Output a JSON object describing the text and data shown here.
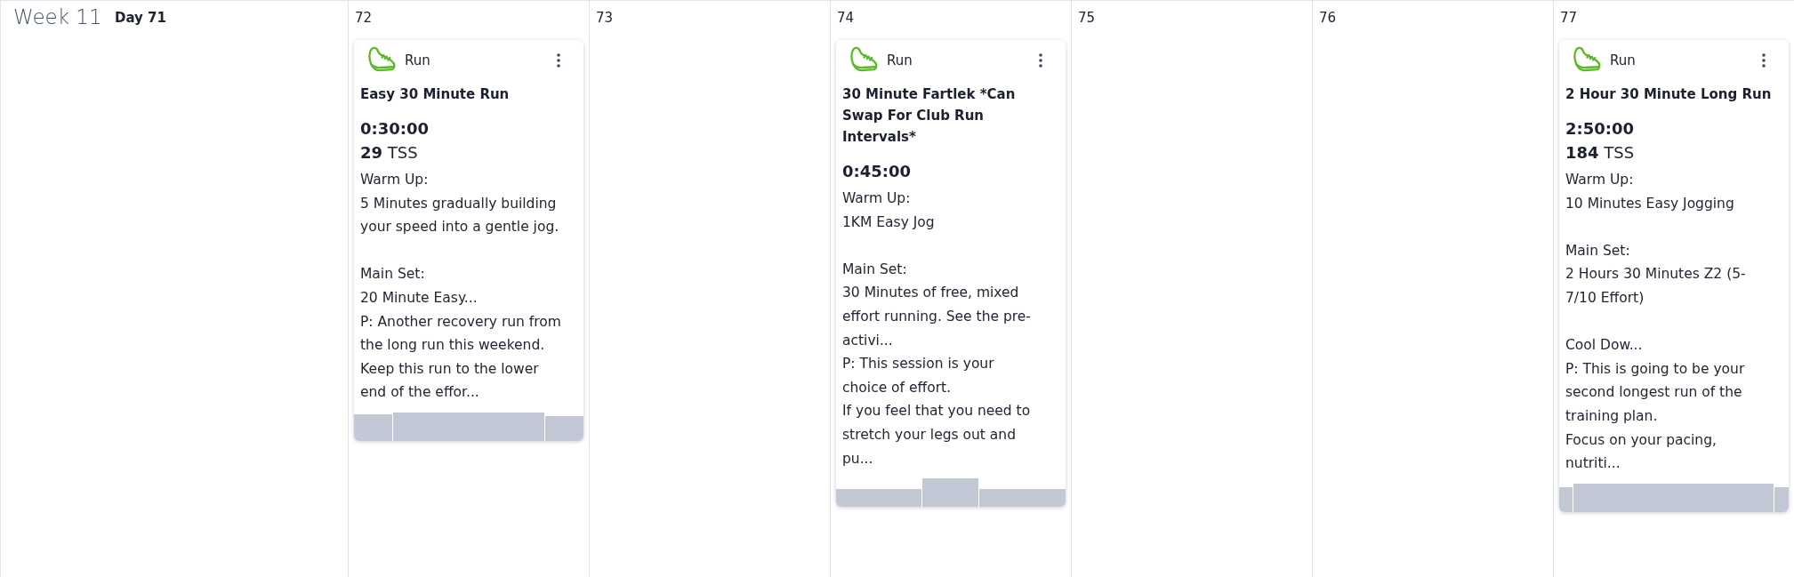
{
  "week": {
    "label": "Week 11"
  },
  "days": [
    {
      "label": "Day 71"
    },
    {
      "label": "72",
      "workouts": [
        {
          "sport": "Run",
          "title": "Easy 30 Minute Run",
          "duration": "0:30:00",
          "tss": "**29** TSS",
          "description": "Warm Up:\n5 Minutes gradually building\nyour speed into a gentle jog.\n\nMain Set:\n20 Minute Easy...\nP: Another recovery run from\nthe long run this weekend.\nKeep this run to the lower\nend of the effor..."
        }
      ]
    },
    {
      "label": "73"
    },
    {
      "label": "74",
      "workouts": [
        {
          "sport": "Run",
          "title": "30 Minute Fartlek *Can Swap For Club Run Intervals*",
          "duration": "0:45:00",
          "description": "Warm Up:\n1KM Easy Jog\n\nMain Set:\n30 Minutes of free, mixed\neffort running. See the pre-\nactivi...\nP: This session is your\nchoice of effort.\nIf you feel that you need to\nstretch your legs out and\npu..."
        }
      ]
    },
    {
      "label": "75"
    },
    {
      "label": "76"
    },
    {
      "label": "77",
      "workouts": [
        {
          "sport": "Run",
          "title": "2 Hour 30 Minute Long Run",
          "duration": "2:50:00",
          "tss": "**184** TSS",
          "description": "Warm Up:\n10 Minutes Easy Jogging\n\nMain Set:\n2 Hours 30 Minutes Z2 (5-\n7/10 Effort)\n\nCool Dow...\nP: This is going to be your\nsecond longest run of the\ntraining plan.\nFocus on your pacing,\nnutriti..."
        }
      ]
    }
  ]
}
